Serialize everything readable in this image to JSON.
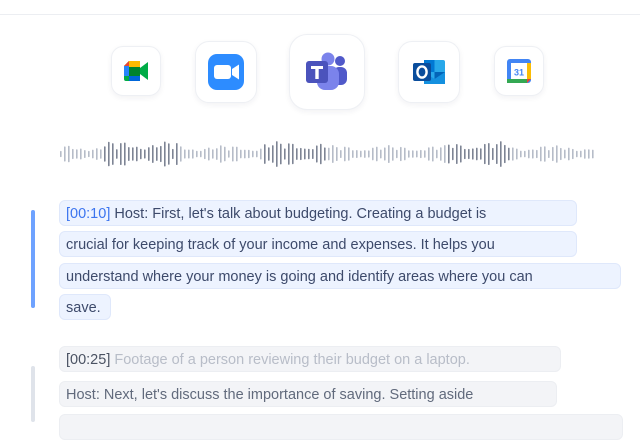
{
  "apps": [
    {
      "name": "Google Meet",
      "icon": "google-meet-icon"
    },
    {
      "name": "Zoom",
      "icon": "zoom-icon"
    },
    {
      "name": "Microsoft Teams",
      "icon": "microsoft-teams-icon"
    },
    {
      "name": "Outlook",
      "icon": "outlook-icon"
    },
    {
      "name": "Google Calendar",
      "icon": "google-calendar-icon",
      "day": "31"
    }
  ],
  "colors": {
    "accent_active": "#6ea2ff",
    "timestamp_active": "#3b74ef",
    "highlight_bg": "#edf3ff",
    "muted_bg": "#f3f4f7",
    "waveform": "#b6bcc8"
  },
  "transcript": [
    {
      "timestamp": "[00:10]",
      "state": "active",
      "lines": [
        "Host: First, let's talk about budgeting. Creating a budget is",
        "crucial for keeping track of your income and expenses. It helps you",
        "understand where your money is going and identify areas where you can",
        "save."
      ]
    },
    {
      "timestamp": "[00:25]",
      "state": "inactive",
      "caption": "Footage of a person reviewing their budget on a laptop.",
      "lines": [
        "Host: Next, let's discuss the importance of saving. Setting aside"
      ]
    }
  ]
}
